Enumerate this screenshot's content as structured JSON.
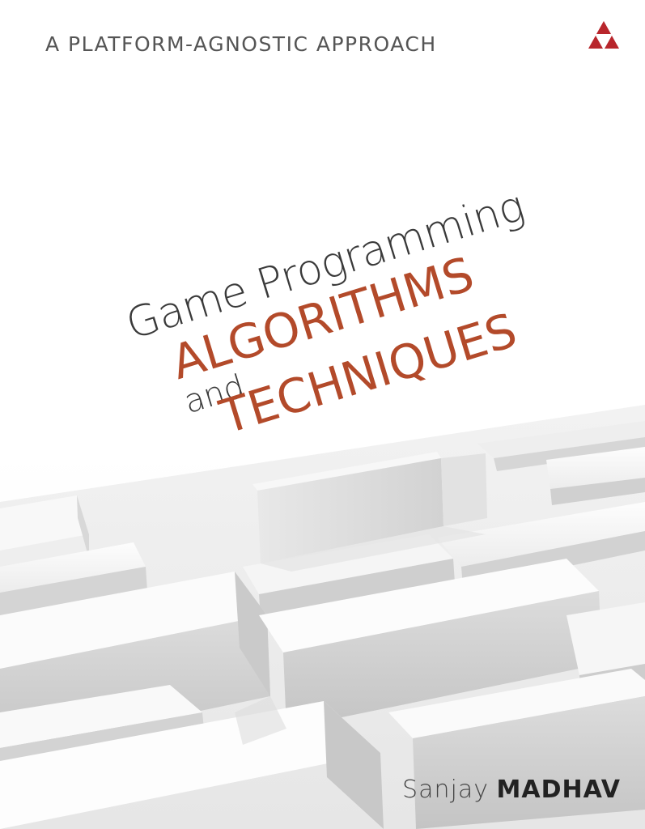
{
  "cover": {
    "tagline": "A PLATFORM-AGNOSTIC APPROACH",
    "title_line1": "Game Programming",
    "title_line2": "ALGORITHMS",
    "title_line3": "and",
    "title_line4": "TECHNIQUES",
    "author_first": "Sanjay",
    "author_last": "MADHAV"
  },
  "colors": {
    "accent": "#b34a2a",
    "logo_red": "#b8262c",
    "text_dark": "#3a3a3a",
    "tagline": "#555555"
  },
  "icons": {
    "publisher_logo": "triangle-logo-icon"
  }
}
